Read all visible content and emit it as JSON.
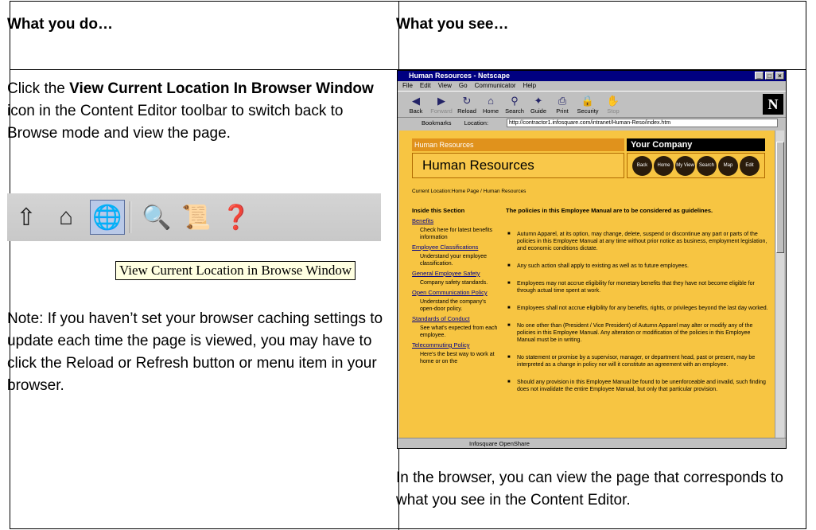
{
  "header": {
    "left": "What you do…",
    "right": "What you see…"
  },
  "instruction": {
    "part1": "Click the ",
    "bold": "View Current Location In Browser Window",
    "part2": " icon in the Content Editor toolbar to switch back to Browse mode and view the page."
  },
  "tooltip": "View Current Location in Browse Window",
  "note": "Note: If you haven’t set your browser caching settings to update each time the page is viewed, you may have to click the Reload or Refresh button or menu item in your browser.",
  "caption": "In the browser, you can view the page that corresponds to what you see in the Content Editor.",
  "browser": {
    "title": "Human Resources - Netscape",
    "menu": [
      "File",
      "Edit",
      "View",
      "Go",
      "Communicator",
      "Help"
    ],
    "nav": [
      "Back",
      "Forward",
      "Reload",
      "Home",
      "Search",
      "Guide",
      "Print",
      "Security",
      "Stop"
    ],
    "bookmarks_label": "Bookmarks",
    "location_label": "Location:",
    "url": "http://contractor1.infosquare.com/intranet/Human-Reso/index.htm",
    "status_text": "Infosquare OpenShare"
  },
  "page": {
    "section_label": "Human Resources",
    "company": "Your Company",
    "title": "Human Resources",
    "buttons": [
      "Back",
      "Home",
      "My View",
      "Search",
      "Map",
      "Edit"
    ],
    "current_location": "Current Location:Home Page / Human Resources",
    "inside_heading": "Inside this Section",
    "sidebar": [
      {
        "link": "Benefits",
        "desc": "Check here for latest benefits information"
      },
      {
        "link": "Employee Classifications",
        "desc": "Understand your employee classification."
      },
      {
        "link": "General Employee Safety",
        "desc": "Company safety standards."
      },
      {
        "link": "Open Communication Policy",
        "desc": "Understand the company's open-door policy."
      },
      {
        "link": "Standards of Conduct",
        "desc": "See what's expected from each employee."
      },
      {
        "link": "Telecommuting Policy",
        "desc": "Here's the best way to work at home or on the"
      }
    ],
    "policy_heading": "The policies in this Employee Manual are to be considered as guidelines.",
    "policies": [
      "Autumn Apparel, at its option, may change, delete, suspend or discontinue any part or parts of the policies in this Employee Manual at any time without prior notice as business, employment legislation, and economic conditions dictate.",
      "Any such action shall apply to existing as well as to future employees.",
      "Employees may not accrue eligibility for monetary benefits that they have not become eligible for through actual time spent at work.",
      "Employees shall not accrue eligibility for any benefits, rights, or privileges beyond the last day worked.",
      "No one other than (President / Vice President) of Autumn Apparel may alter or modify any of the policies in this Employee Manual. Any alteration or modification of the policies in this Employee Manual must be in writing.",
      "No statement or promise by a supervisor, manager, or department head, past or present, may be interpreted as a change in policy nor will it constitute an agreement with an employee.",
      "Should any provision in this Employee Manual be found to be unenforceable and invalid, such finding does not invalidate the entire Employee Manual, but only that particular provision."
    ]
  },
  "colors": {
    "page_bg": "#f7c542",
    "title_bar": "#000080",
    "nav_button": "#2a1c0c",
    "header_orange": "#e0921c"
  }
}
